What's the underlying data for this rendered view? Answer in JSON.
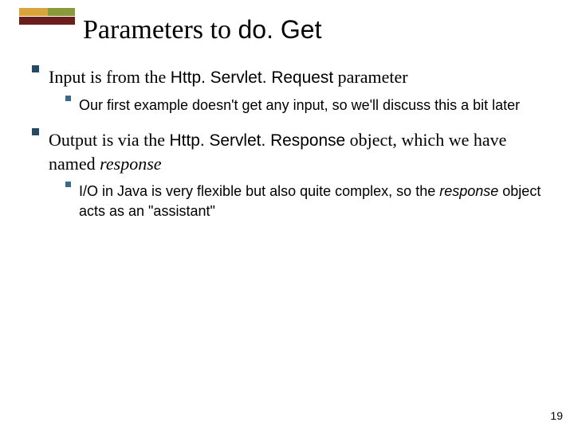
{
  "title": {
    "pre": "Parameters to ",
    "code": "do. Get"
  },
  "bullets": [
    {
      "pre": "Input is from the ",
      "code": "Http. Servlet. Request",
      "post": " parameter",
      "sub": [
        {
          "text": "Our first example doesn't get any input, so we'll discuss this a bit later"
        }
      ]
    },
    {
      "pre": " Output is via the ",
      "code": "Http. Servlet. Response",
      "post1": " object, which we have named ",
      "italic": "response",
      "sub": [
        {
          "pre": "I/O in Java is very flexible but also quite complex, so the ",
          "italic": "response",
          "post": " object acts as an \"assistant\""
        }
      ]
    }
  ],
  "page_number": "19"
}
